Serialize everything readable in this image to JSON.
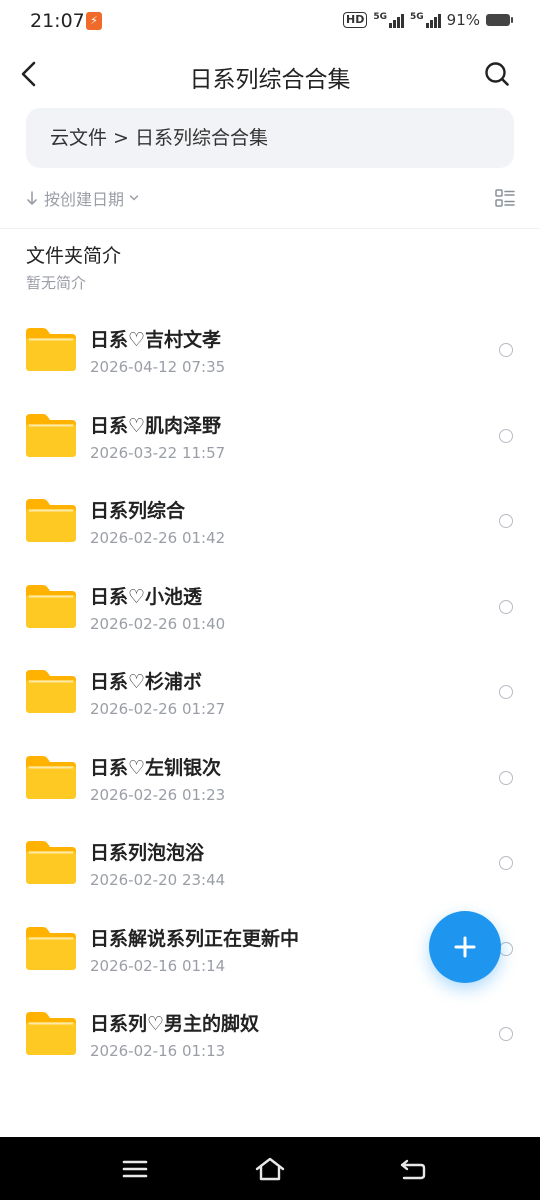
{
  "status_bar": {
    "time": "21:07",
    "battery": "91%",
    "network_1": "5G",
    "network_2": "5G",
    "hd_label": "HD"
  },
  "header": {
    "title": "日系列综合合集"
  },
  "breadcrumb": {
    "path": "云文件 > 日系列综合合集"
  },
  "sort": {
    "label": "按创建日期"
  },
  "folder_intro": {
    "title": "文件夹简介",
    "description": "暂无简介"
  },
  "folders": [
    {
      "name": "日系♡吉村文孝",
      "date": "2026-04-12 07:35"
    },
    {
      "name": "日系♡肌肉泽野",
      "date": "2026-03-22 11:57"
    },
    {
      "name": "日系列综合",
      "date": "2026-02-26 01:42"
    },
    {
      "name": "日系♡小池透",
      "date": "2026-02-26 01:40"
    },
    {
      "name": "日系♡杉浦ボ",
      "date": "2026-02-26 01:27"
    },
    {
      "name": "日系♡左钏银次",
      "date": "2026-02-26 01:23"
    },
    {
      "name": "日系列泡泡浴",
      "date": "2026-02-20 23:44"
    },
    {
      "name": "日系解说系列正在更新中",
      "date": "2026-02-16 01:14"
    },
    {
      "name": "日系列♡男主的脚奴",
      "date": "2026-02-16 01:13"
    }
  ],
  "colors": {
    "accent": "#1e96f0",
    "folder": "#ffc20e",
    "muted_text": "#9a9ea6"
  },
  "icons": {
    "back": "chevron-left-icon",
    "search": "search-icon",
    "sort": "arrow-down-icon",
    "view": "list-view-icon",
    "folder": "folder-icon",
    "add": "plus-icon"
  }
}
